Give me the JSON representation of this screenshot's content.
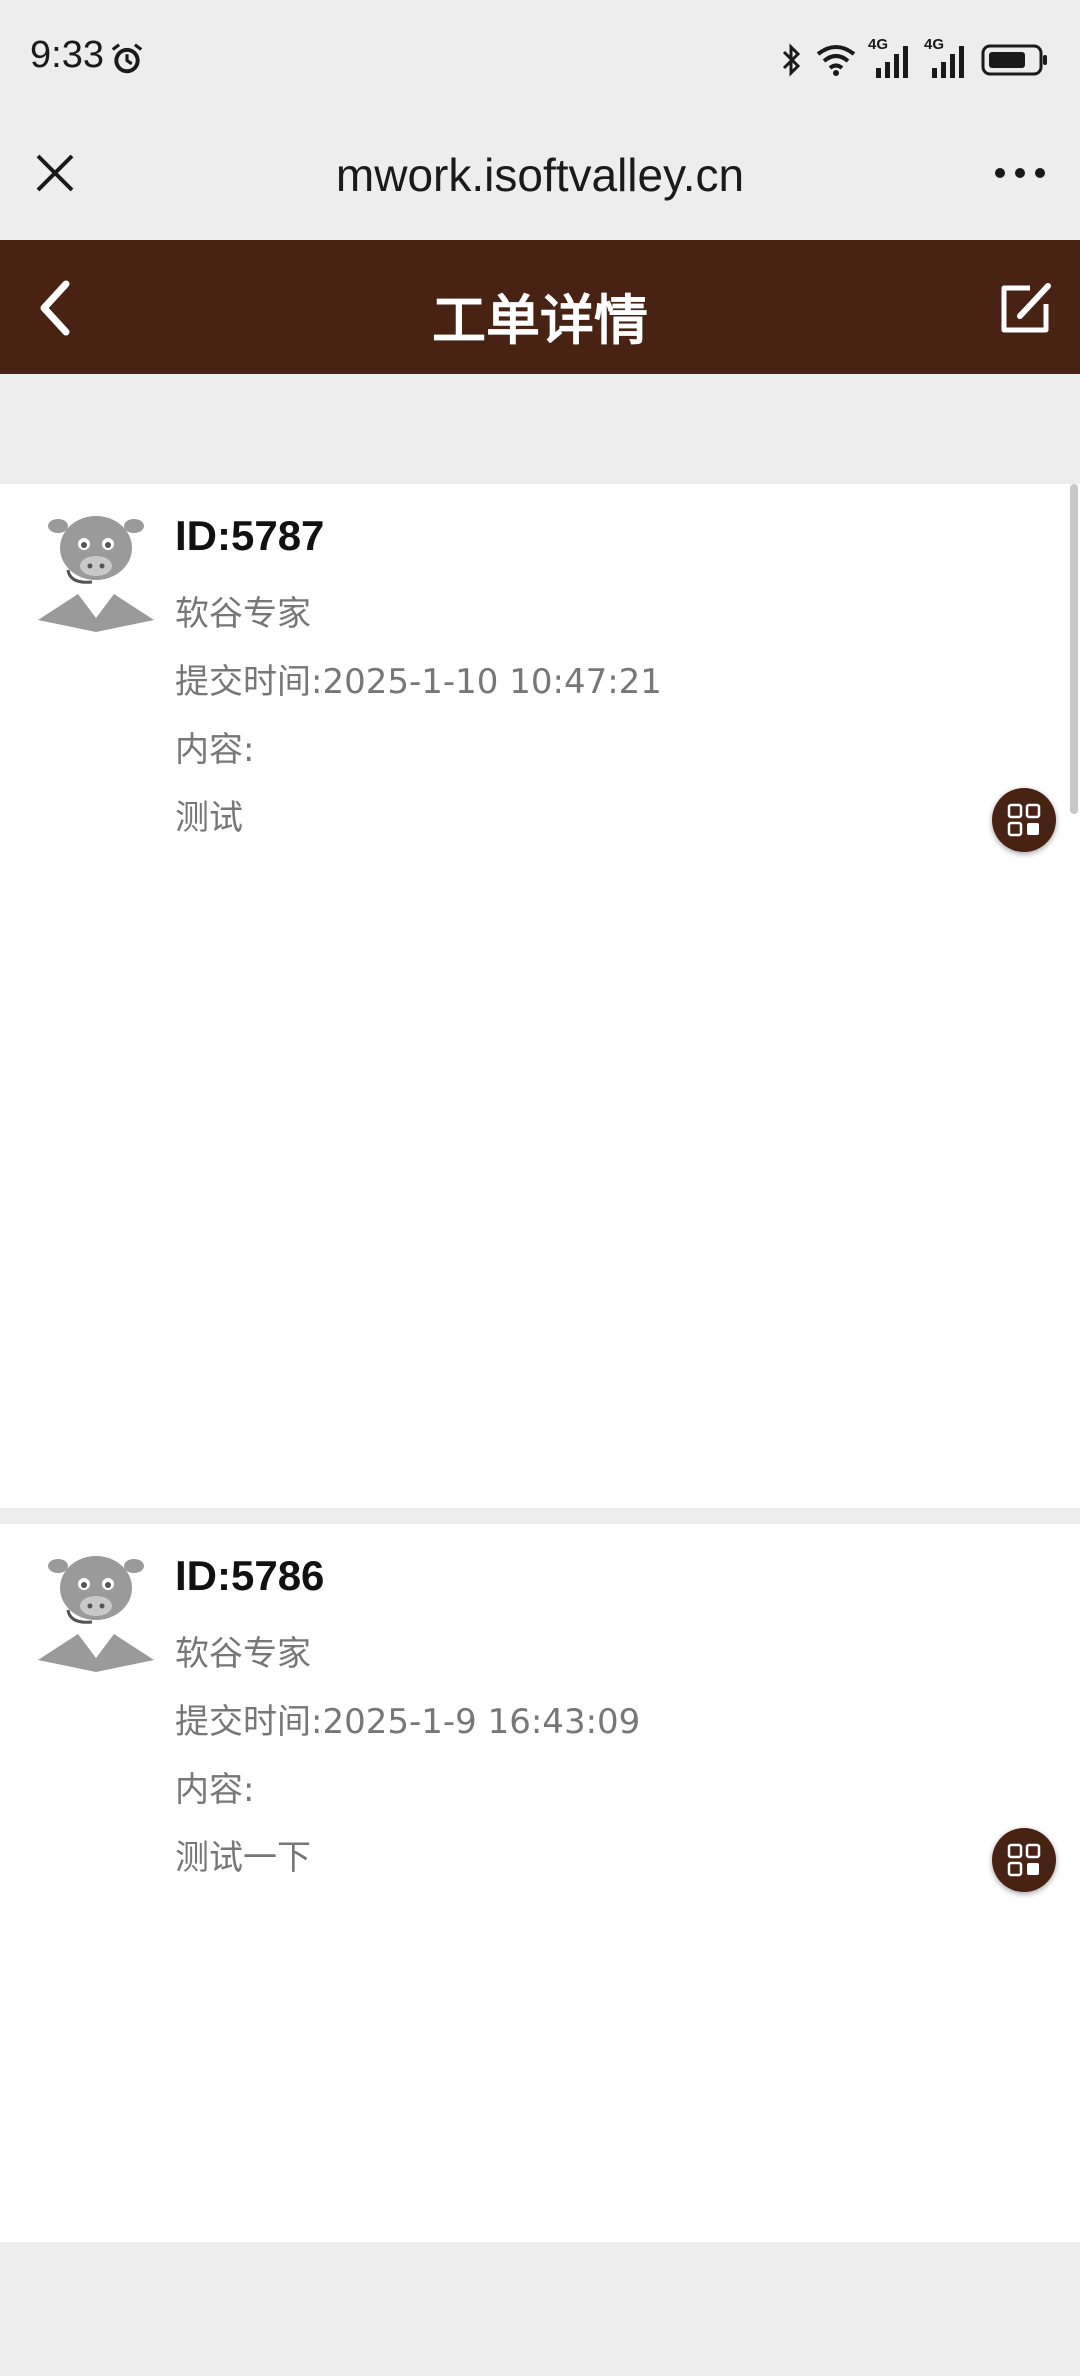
{
  "status_bar": {
    "time": "9:33",
    "icons": [
      "alarm-icon",
      "bluetooth-icon",
      "wifi-icon",
      "signal-4g-icon",
      "signal-4g-icon",
      "battery-icon"
    ],
    "network_label_1": "4G",
    "network_label_2": "4G"
  },
  "browser": {
    "url": "mwork.isoftvalley.cn",
    "close_icon": "close-icon",
    "more_icon": "more-icon"
  },
  "header": {
    "title": "工单详情",
    "back_icon": "chevron-left-icon",
    "edit_icon": "edit-icon",
    "background": "#482313"
  },
  "tickets": [
    {
      "id": "ID:5787",
      "author": "软谷专家",
      "submit_time": "提交时间:2025-1-10 10:47:21",
      "content_label": "内容:",
      "content": "测试"
    },
    {
      "id": "ID:5786",
      "author": "软谷专家",
      "submit_time": "提交时间:2025-1-9 16:43:09",
      "content_label": "内容:",
      "content": "测试一下"
    }
  ],
  "colors": {
    "accent": "#482313",
    "page_bg": "#ededed",
    "text_muted": "#777777"
  }
}
